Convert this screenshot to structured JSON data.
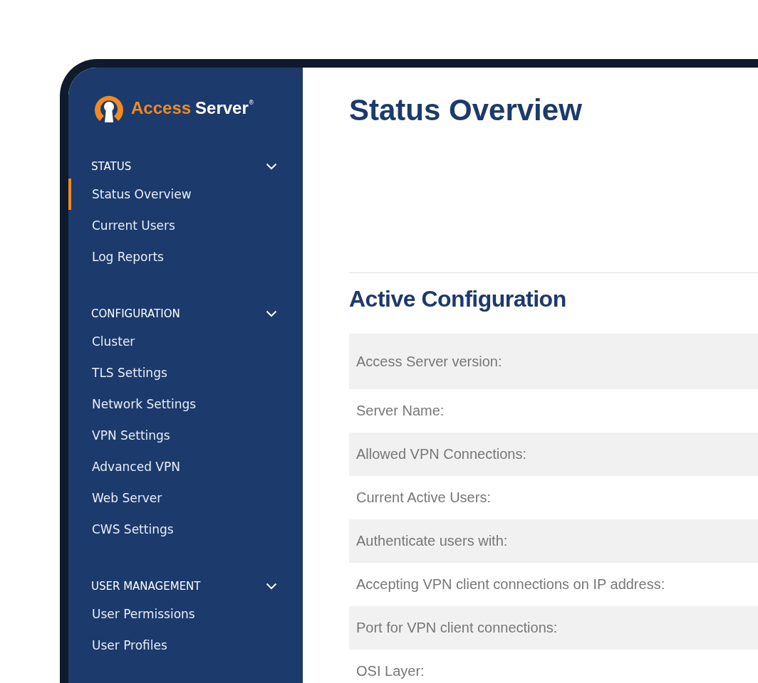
{
  "logo": {
    "brand": "Access",
    "product": "Server",
    "mark": "®"
  },
  "sidebar": {
    "sections": [
      {
        "title": "STATUS",
        "expanded": true,
        "items": [
          {
            "label": "Status Overview",
            "selected": true
          },
          {
            "label": "Current Users",
            "selected": false
          },
          {
            "label": "Log Reports",
            "selected": false
          }
        ]
      },
      {
        "title": "CONFIGURATION",
        "expanded": true,
        "items": [
          {
            "label": "Cluster",
            "selected": false
          },
          {
            "label": "TLS Settings",
            "selected": false
          },
          {
            "label": "Network Settings",
            "selected": false
          },
          {
            "label": "VPN Settings",
            "selected": false
          },
          {
            "label": "Advanced VPN",
            "selected": false
          },
          {
            "label": "Web Server",
            "selected": false
          },
          {
            "label": "CWS Settings",
            "selected": false
          }
        ]
      },
      {
        "title": "USER MANAGEMENT",
        "expanded": true,
        "items": [
          {
            "label": "User Permissions",
            "selected": false
          },
          {
            "label": "User Profiles",
            "selected": false
          }
        ]
      }
    ]
  },
  "main": {
    "title": "Status Overview",
    "section_title": "Active Configuration",
    "rows": [
      {
        "label": "Access Server version:"
      },
      {
        "label": "Server Name:"
      },
      {
        "label": "Allowed VPN Connections:"
      },
      {
        "label": "Current Active Users:"
      },
      {
        "label": "Authenticate users with:"
      },
      {
        "label": "Accepting VPN client connections on IP address:"
      },
      {
        "label": "Port for VPN client connections:"
      },
      {
        "label": "OSI Layer:"
      }
    ]
  }
}
